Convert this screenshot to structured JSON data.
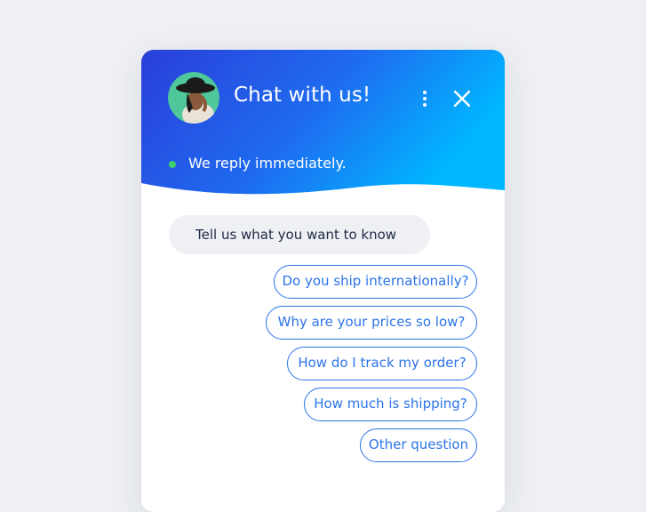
{
  "chat": {
    "title": "Chat with us!",
    "status_text": "We reply immediately.",
    "bot_message": "Tell us what you want to know",
    "options": [
      "Do you ship internationally?",
      "Why are your prices so low?",
      "How do I track my order?",
      "How much is shipping?",
      "Other question"
    ]
  },
  "colors": {
    "gradient_start": "#2a3fd8",
    "gradient_end": "#00b6ff",
    "accent": "#2b74e8",
    "status_online": "#3ecf6e"
  },
  "icons": {
    "menu": "more-vertical-icon",
    "close": "close-icon"
  }
}
